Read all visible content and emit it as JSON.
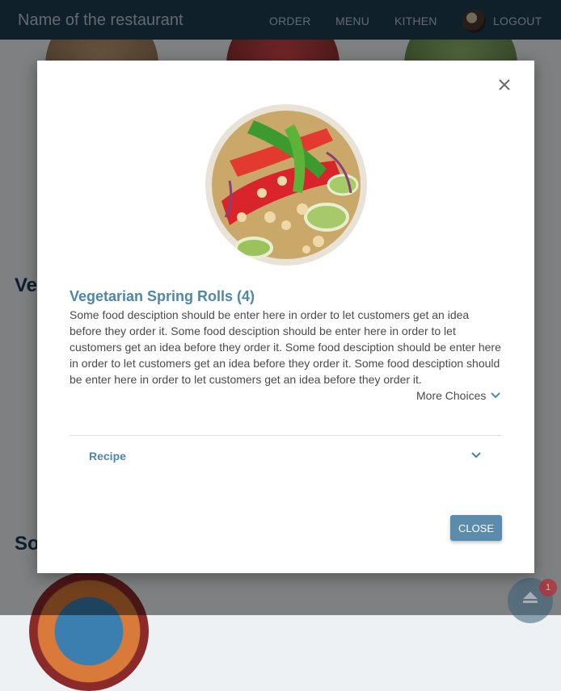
{
  "navbar": {
    "title": "Name of the restaurant",
    "links": [
      "ORDER",
      "MENU",
      "KITHEN"
    ],
    "logout": "LOGOUT"
  },
  "background": {
    "section_headings": [
      "Ve",
      "So"
    ]
  },
  "modal": {
    "title": "Vegetarian Spring Rolls (4)",
    "description": "Some food desciption should be enter here in order to let customers get an idea before they order it. Some food desciption should be enter here in order to let customers get an idea before they order it. Some food desciption should be enter here in order to let customers get an idea before they order it. Some food desciption should be enter here in order to let customers get an idea before they order it.",
    "more_choices": "More Choices",
    "recipe_label": "Recipe",
    "close_label": "CLOSE"
  },
  "cart": {
    "badge_count": "1"
  },
  "colors": {
    "navbar": "#1f3d52",
    "accent": "#4f86ac",
    "button": "#5b8cad",
    "badge": "#b0323a"
  },
  "icons": [
    "close-icon",
    "chevron-down-icon",
    "eject-icon",
    "avatar"
  ]
}
